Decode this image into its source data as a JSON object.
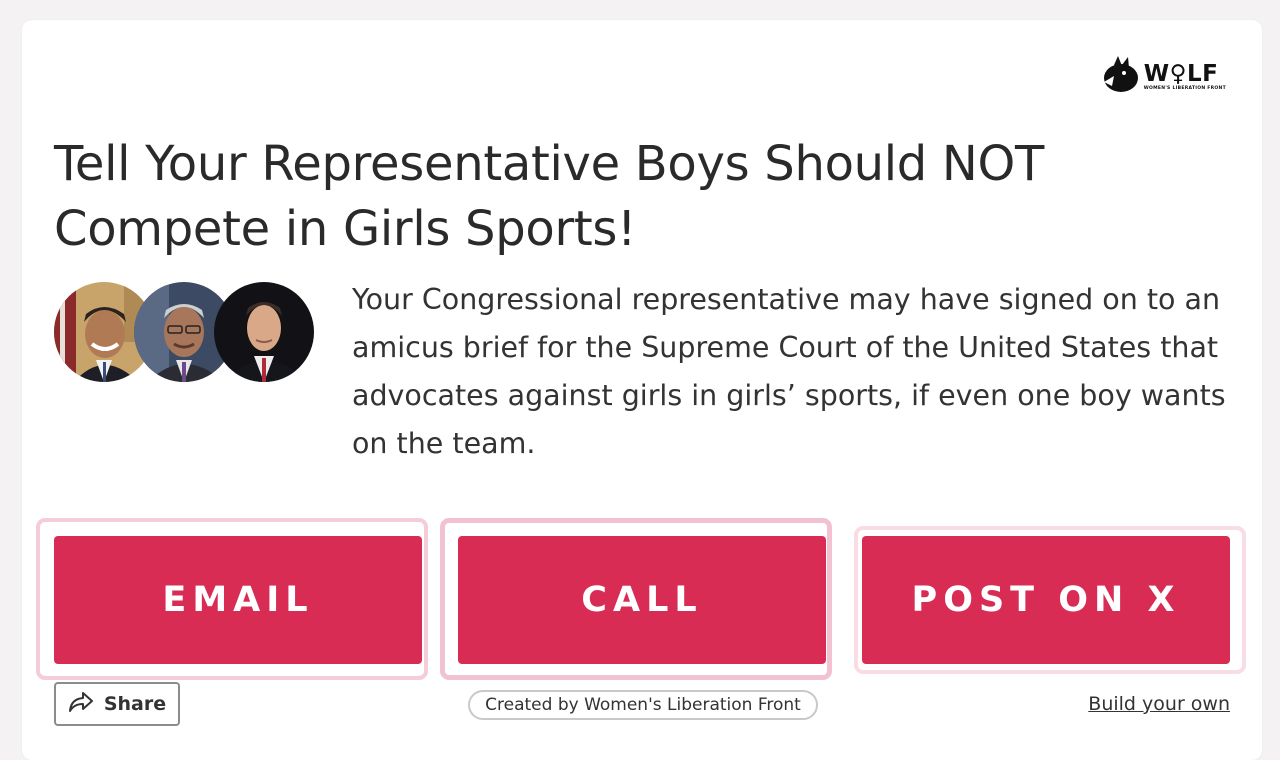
{
  "logo": {
    "wordmark": "W♀LF",
    "tagline": "WOMEN'S LIBERATION FRONT",
    "icon": "wolf-head-icon"
  },
  "campaign": {
    "title": "Tell Your Representative Boys Should NOT Compete in Girls Sports!",
    "description": "Your Congressional representative may have signed on to an amicus brief for the Supreme Court of the United States that advocates against girls in girls’ sports, if even one boy wants on the team."
  },
  "actions": {
    "email_label": "EMAIL",
    "call_label": "CALL",
    "post_label": "POST ON X"
  },
  "footer": {
    "share_label": "Share",
    "share_icon": "share-arrow-icon",
    "created_by": "Created by Women's Liberation Front",
    "build_own": "Build your own"
  },
  "colors": {
    "accent": "#d82c55",
    "background": "#f4f2f3"
  }
}
